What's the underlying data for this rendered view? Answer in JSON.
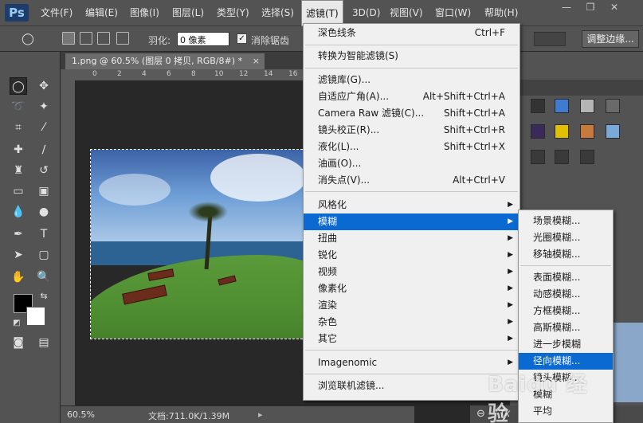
{
  "app": {
    "logo": "Ps"
  },
  "menubar": {
    "items": [
      "文件(F)",
      "编辑(E)",
      "图像(I)",
      "图层(L)",
      "类型(Y)",
      "选择(S)",
      "滤镜(T)",
      "3D(D)",
      "视图(V)",
      "窗口(W)",
      "帮助(H)"
    ],
    "active": "滤镜(T)"
  },
  "options": {
    "feather_label": "羽化:",
    "feather_value": "0 像素",
    "antialias_label": "消除锯齿",
    "antialias_checked": true,
    "refine_edge": "调整边缘..."
  },
  "document": {
    "tab_title": "1.png @ 60.5% (图层 0 拷贝, RGB/8#) *",
    "ruler_ticks": [
      "0",
      "2",
      "4",
      "6",
      "8",
      "10",
      "12",
      "14",
      "16"
    ]
  },
  "status": {
    "zoom": "60.5%",
    "doc_info": "文档:711.0K/1.39M"
  },
  "filter_menu": {
    "items": [
      {
        "label": "深色线条",
        "shortcut": "Ctrl+F"
      },
      {
        "label": "转换为智能滤镜(S)"
      },
      {
        "label": "滤镜库(G)..."
      },
      {
        "label": "自适应广角(A)...",
        "shortcut": "Alt+Shift+Ctrl+A"
      },
      {
        "label": "Camera Raw 滤镜(C)...",
        "shortcut": "Shift+Ctrl+A"
      },
      {
        "label": "镜头校正(R)...",
        "shortcut": "Shift+Ctrl+R"
      },
      {
        "label": "液化(L)...",
        "shortcut": "Shift+Ctrl+X"
      },
      {
        "label": "油画(O)..."
      },
      {
        "label": "消失点(V)...",
        "shortcut": "Alt+Ctrl+V"
      },
      {
        "label": "风格化"
      },
      {
        "label": "模糊"
      },
      {
        "label": "扭曲"
      },
      {
        "label": "锐化"
      },
      {
        "label": "视频"
      },
      {
        "label": "像素化"
      },
      {
        "label": "渲染"
      },
      {
        "label": "杂色"
      },
      {
        "label": "其它"
      },
      {
        "label": "Imagenomic"
      },
      {
        "label": "浏览联机滤镜..."
      }
    ],
    "highlighted": "模糊"
  },
  "blur_submenu": {
    "items": [
      "场景模糊...",
      "光圈模糊...",
      "移轴模糊...",
      "表面模糊...",
      "动感模糊...",
      "方框模糊...",
      "高斯模糊...",
      "进一步模糊",
      "径向模糊...",
      "镜头模糊...",
      "模糊",
      "平均"
    ],
    "highlighted": "径向模糊..."
  },
  "watermark": "Baidu 经验",
  "colors": {
    "menu_highlight": "#0a6ad2",
    "chrome": "#535353",
    "canvas_bg": "#282828"
  },
  "icons": [
    "marquee-icon",
    "move-icon",
    "lasso-icon",
    "magic-wand-icon",
    "crop-icon",
    "eyedropper-icon",
    "healing-brush-icon",
    "brush-icon",
    "clone-stamp-icon",
    "history-brush-icon",
    "eraser-icon",
    "gradient-icon",
    "blur-icon",
    "dodge-icon",
    "pen-icon",
    "type-icon",
    "path-select-icon",
    "shape-icon",
    "hand-icon",
    "zoom-icon",
    "quick-mask-icon",
    "screen-mode-icon"
  ]
}
